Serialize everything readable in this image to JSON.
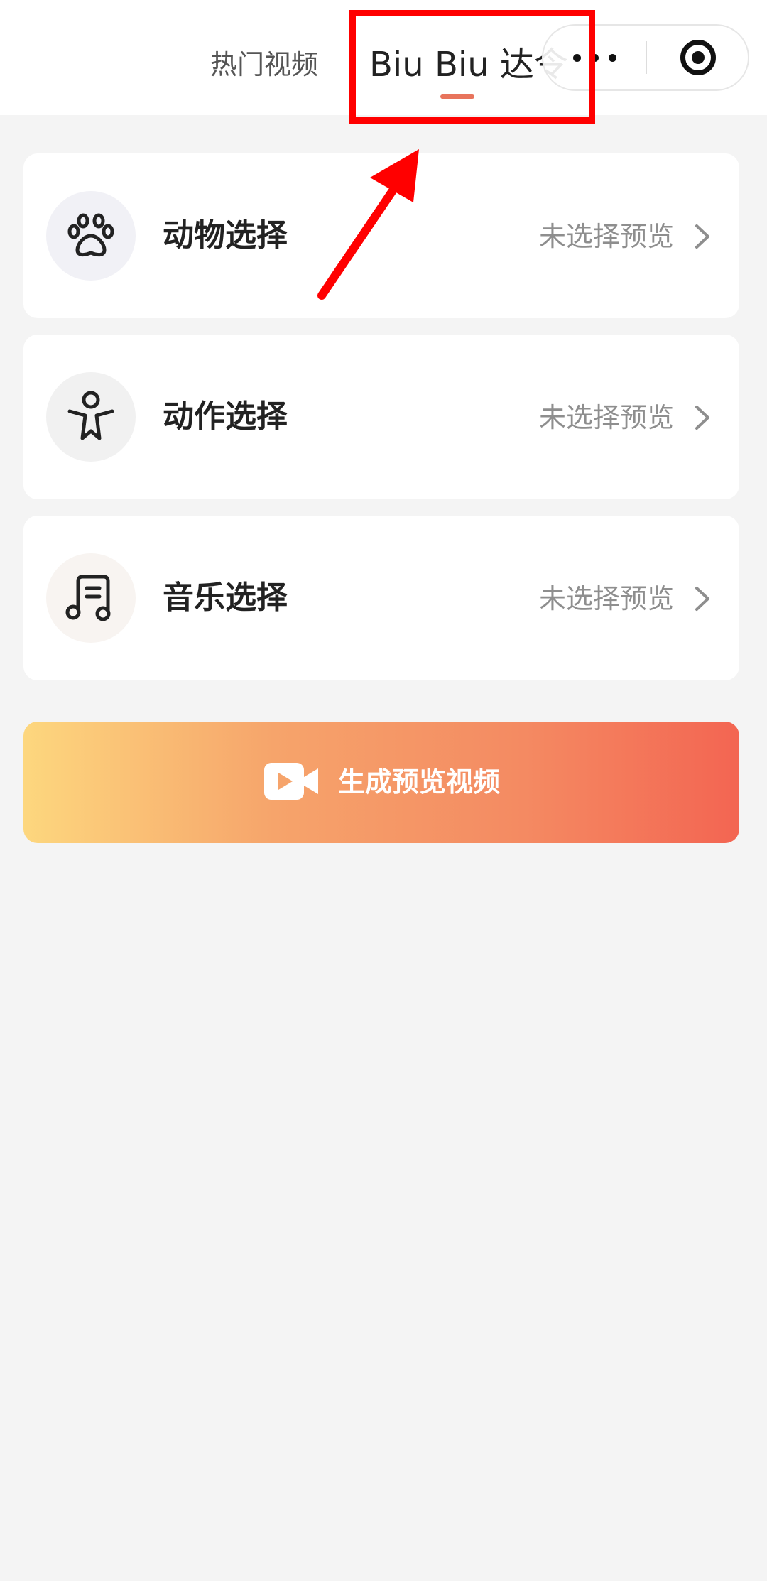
{
  "header": {
    "tabs": [
      {
        "label": "热门视频",
        "active": false
      },
      {
        "label": "Biu Biu 达令",
        "active": true
      }
    ],
    "accent_color": "#e8745c",
    "capsule": {
      "more_icon": "more-dots-icon",
      "close_icon": "target-circle-icon"
    }
  },
  "selections": [
    {
      "label": "动物选择",
      "status": "未选择预览",
      "icon": "paw-icon"
    },
    {
      "label": "动作选择",
      "status": "未选择预览",
      "icon": "person-pose-icon"
    },
    {
      "label": "音乐选择",
      "status": "未选择预览",
      "icon": "music-note-icon"
    }
  ],
  "generate_button": {
    "label": "生成预览视频",
    "icon": "video-camera-icon",
    "gradient": [
      "#fdd77e",
      "#f36552"
    ]
  },
  "annotation": {
    "color": "#ff0000",
    "shapes": [
      "highlight-box",
      "pointer-arrow"
    ]
  }
}
